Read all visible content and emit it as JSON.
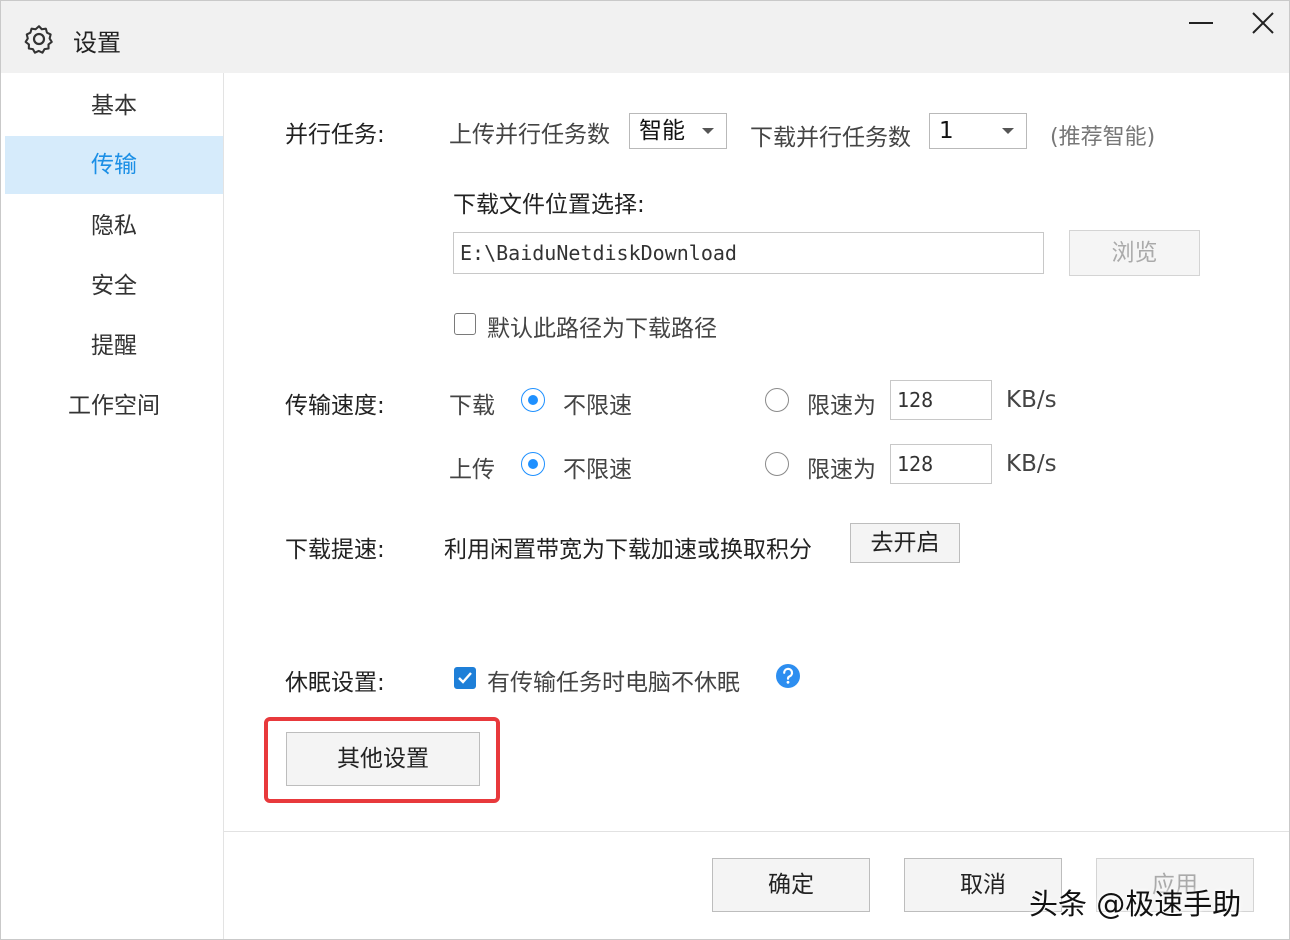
{
  "window": {
    "title": "设置",
    "icon": "gear-icon",
    "controls": [
      "minimize-icon",
      "close-icon"
    ]
  },
  "sidebar": {
    "items": [
      {
        "label": "基本",
        "active": false
      },
      {
        "label": "传输",
        "active": true
      },
      {
        "label": "隐私",
        "active": false
      },
      {
        "label": "安全",
        "active": false
      },
      {
        "label": "提醒",
        "active": false
      },
      {
        "label": "工作空间",
        "active": false
      }
    ]
  },
  "parallel": {
    "label": "并行任务:",
    "upload_label": "上传并行任务数",
    "upload_value": "智能",
    "download_label": "下载并行任务数",
    "download_value": "1",
    "hint": "(推荐智能)"
  },
  "download_location": {
    "label": "下载文件位置选择:",
    "path": "E:\\BaiduNetdiskDownload",
    "browse_label": "浏览",
    "default_checkbox_label": "默认此路径为下载路径",
    "default_checked": false
  },
  "speed": {
    "label": "传输速度:",
    "download": {
      "label": "下载",
      "unlimited_label": "不限速",
      "limit_label": "限速为",
      "limit_value": "128",
      "unit": "KB/s",
      "selected": "unlimited"
    },
    "upload": {
      "label": "上传",
      "unlimited_label": "不限速",
      "limit_label": "限速为",
      "limit_value": "128",
      "unit": "KB/s",
      "selected": "unlimited"
    }
  },
  "boost": {
    "label": "下载提速:",
    "desc": "利用闲置带宽为下载加速或换取积分",
    "button_label": "去开启"
  },
  "sleep": {
    "label": "休眠设置:",
    "checkbox_label": "有传输任务时电脑不休眠",
    "checked": true,
    "help_icon": "question-icon"
  },
  "other_settings_label": "其他设置",
  "footer": {
    "ok_label": "确定",
    "cancel_label": "取消",
    "apply_label": "应用"
  },
  "watermark": "头条 @极速手助",
  "colors": {
    "accent": "#1b8fe6",
    "sidebar_active_bg": "#d6ebfb",
    "highlight": "#e8393c",
    "titlebar": "#f1f1f1"
  }
}
